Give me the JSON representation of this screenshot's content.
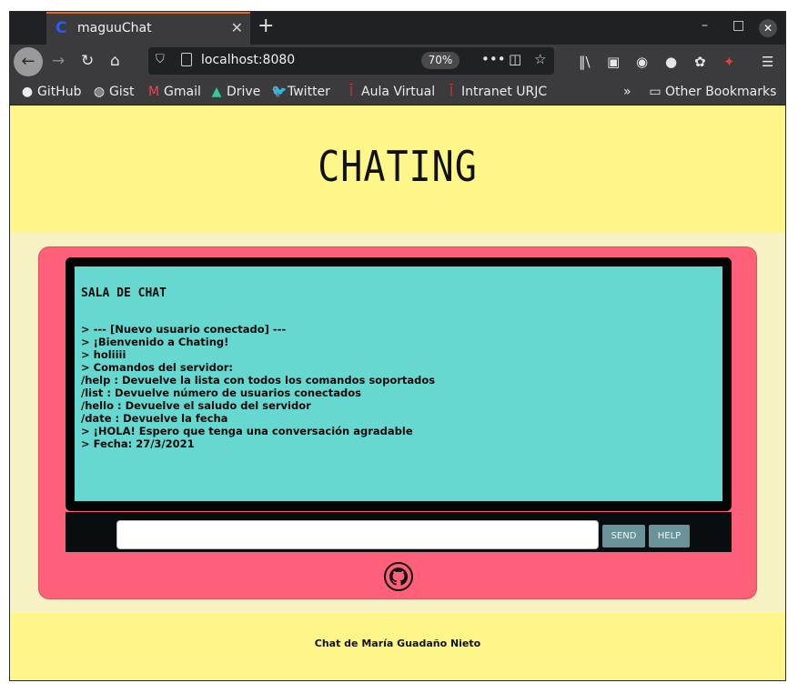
{
  "browser": {
    "tab_title": "maguuChat",
    "favicon_glyph": "C",
    "url": "localhost:8080",
    "zoom": "70%",
    "window_buttons": {
      "minimize": "–",
      "maximize": "□",
      "close": "✕"
    },
    "bookmarks": [
      {
        "label": "GitHub",
        "icon": "github-icon"
      },
      {
        "label": "Gist",
        "icon": "globe-icon"
      },
      {
        "label": "Gmail",
        "icon": "gmail-icon"
      },
      {
        "label": "Drive",
        "icon": "drive-icon"
      },
      {
        "label": "Twitter",
        "icon": "twitter-icon"
      },
      {
        "label": "Aula Virtual",
        "icon": "urjc-icon"
      },
      {
        "label": "Intranet URJC",
        "icon": "urjc-icon"
      }
    ],
    "other_bookmarks": "Other Bookmarks"
  },
  "page": {
    "heading": "CHATING",
    "chat": {
      "title": "SALA DE CHAT",
      "messages": [
        "> --- [Nuevo usuario conectado] ---",
        "> ¡Bienvenido a Chating!",
        "> holiiii",
        "> Comandos del servidor:",
        "/help : Devuelve la lista con todos los comandos soportados",
        "/list : Devuelve número de usuarios conectados",
        "/hello : Devuelve el saludo del servidor",
        "/date : Devuelve la fecha",
        "> ¡HOLA! Espero que tenga una conversación agradable",
        "> Fecha: 27/3/2021"
      ]
    },
    "input": {
      "value": "",
      "placeholder": ""
    },
    "send_label": "SEND",
    "help_label": "HELP",
    "footer": "Chat de María Guadaño Nieto"
  },
  "colors": {
    "header_bg": "#fff68a",
    "panel_bg": "#fe6079",
    "screen_bg": "#66d8d0",
    "button_bg": "#6a9399"
  }
}
